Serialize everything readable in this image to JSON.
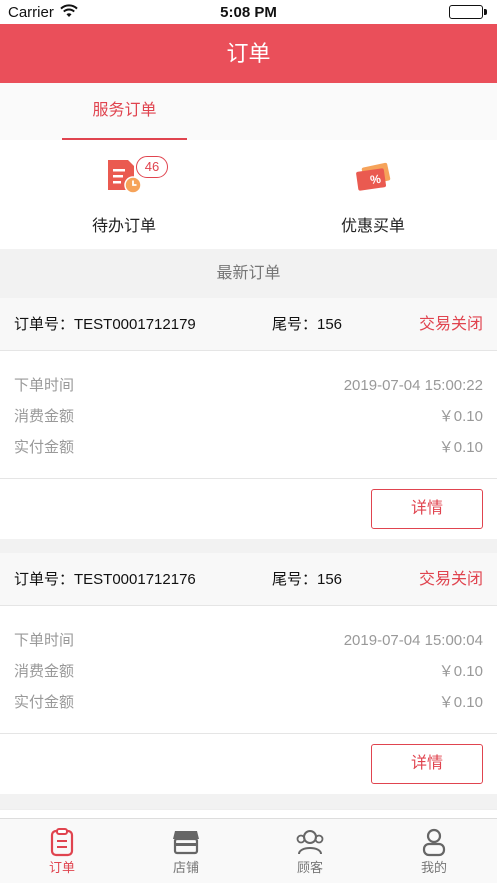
{
  "status_bar": {
    "carrier": "Carrier",
    "time": "5:08 PM"
  },
  "nav": {
    "title": "订单"
  },
  "top_tabs": [
    {
      "label": "服务订单"
    }
  ],
  "quick_actions": [
    {
      "label": "待办订单",
      "badge": "46",
      "icon": "todo-orders-icon"
    },
    {
      "label": "优惠买单",
      "icon": "discount-coupon-icon"
    }
  ],
  "section": {
    "title": "最新订单"
  },
  "orders": [
    {
      "order_no": "订单号：TEST0001712179",
      "tail": "尾号：156",
      "status": "交易关闭",
      "rows": [
        {
          "label": "下单时间",
          "value": "2019-07-04 15:00:22"
        },
        {
          "label": "消费金额",
          "value": "￥0.10"
        },
        {
          "label": "实付金额",
          "value": "￥0.10"
        }
      ],
      "detail_label": "详情"
    },
    {
      "order_no": "订单号：TEST0001712176",
      "tail": "尾号：156",
      "status": "交易关闭",
      "rows": [
        {
          "label": "下单时间",
          "value": "2019-07-04 15:00:04"
        },
        {
          "label": "消费金额",
          "value": "￥0.10"
        },
        {
          "label": "实付金额",
          "value": "￥0.10"
        }
      ],
      "detail_label": "详情"
    }
  ],
  "bottom_tabs": [
    {
      "label": "订单",
      "icon": "clipboard-icon",
      "active": true
    },
    {
      "label": "店铺",
      "icon": "store-icon"
    },
    {
      "label": "顾客",
      "icon": "customers-icon"
    },
    {
      "label": "我的",
      "icon": "profile-icon"
    }
  ],
  "colors": {
    "accent": "#ea4f5a",
    "accent_text": "#e0444f",
    "muted": "#999999",
    "battery": "#4cd964"
  }
}
